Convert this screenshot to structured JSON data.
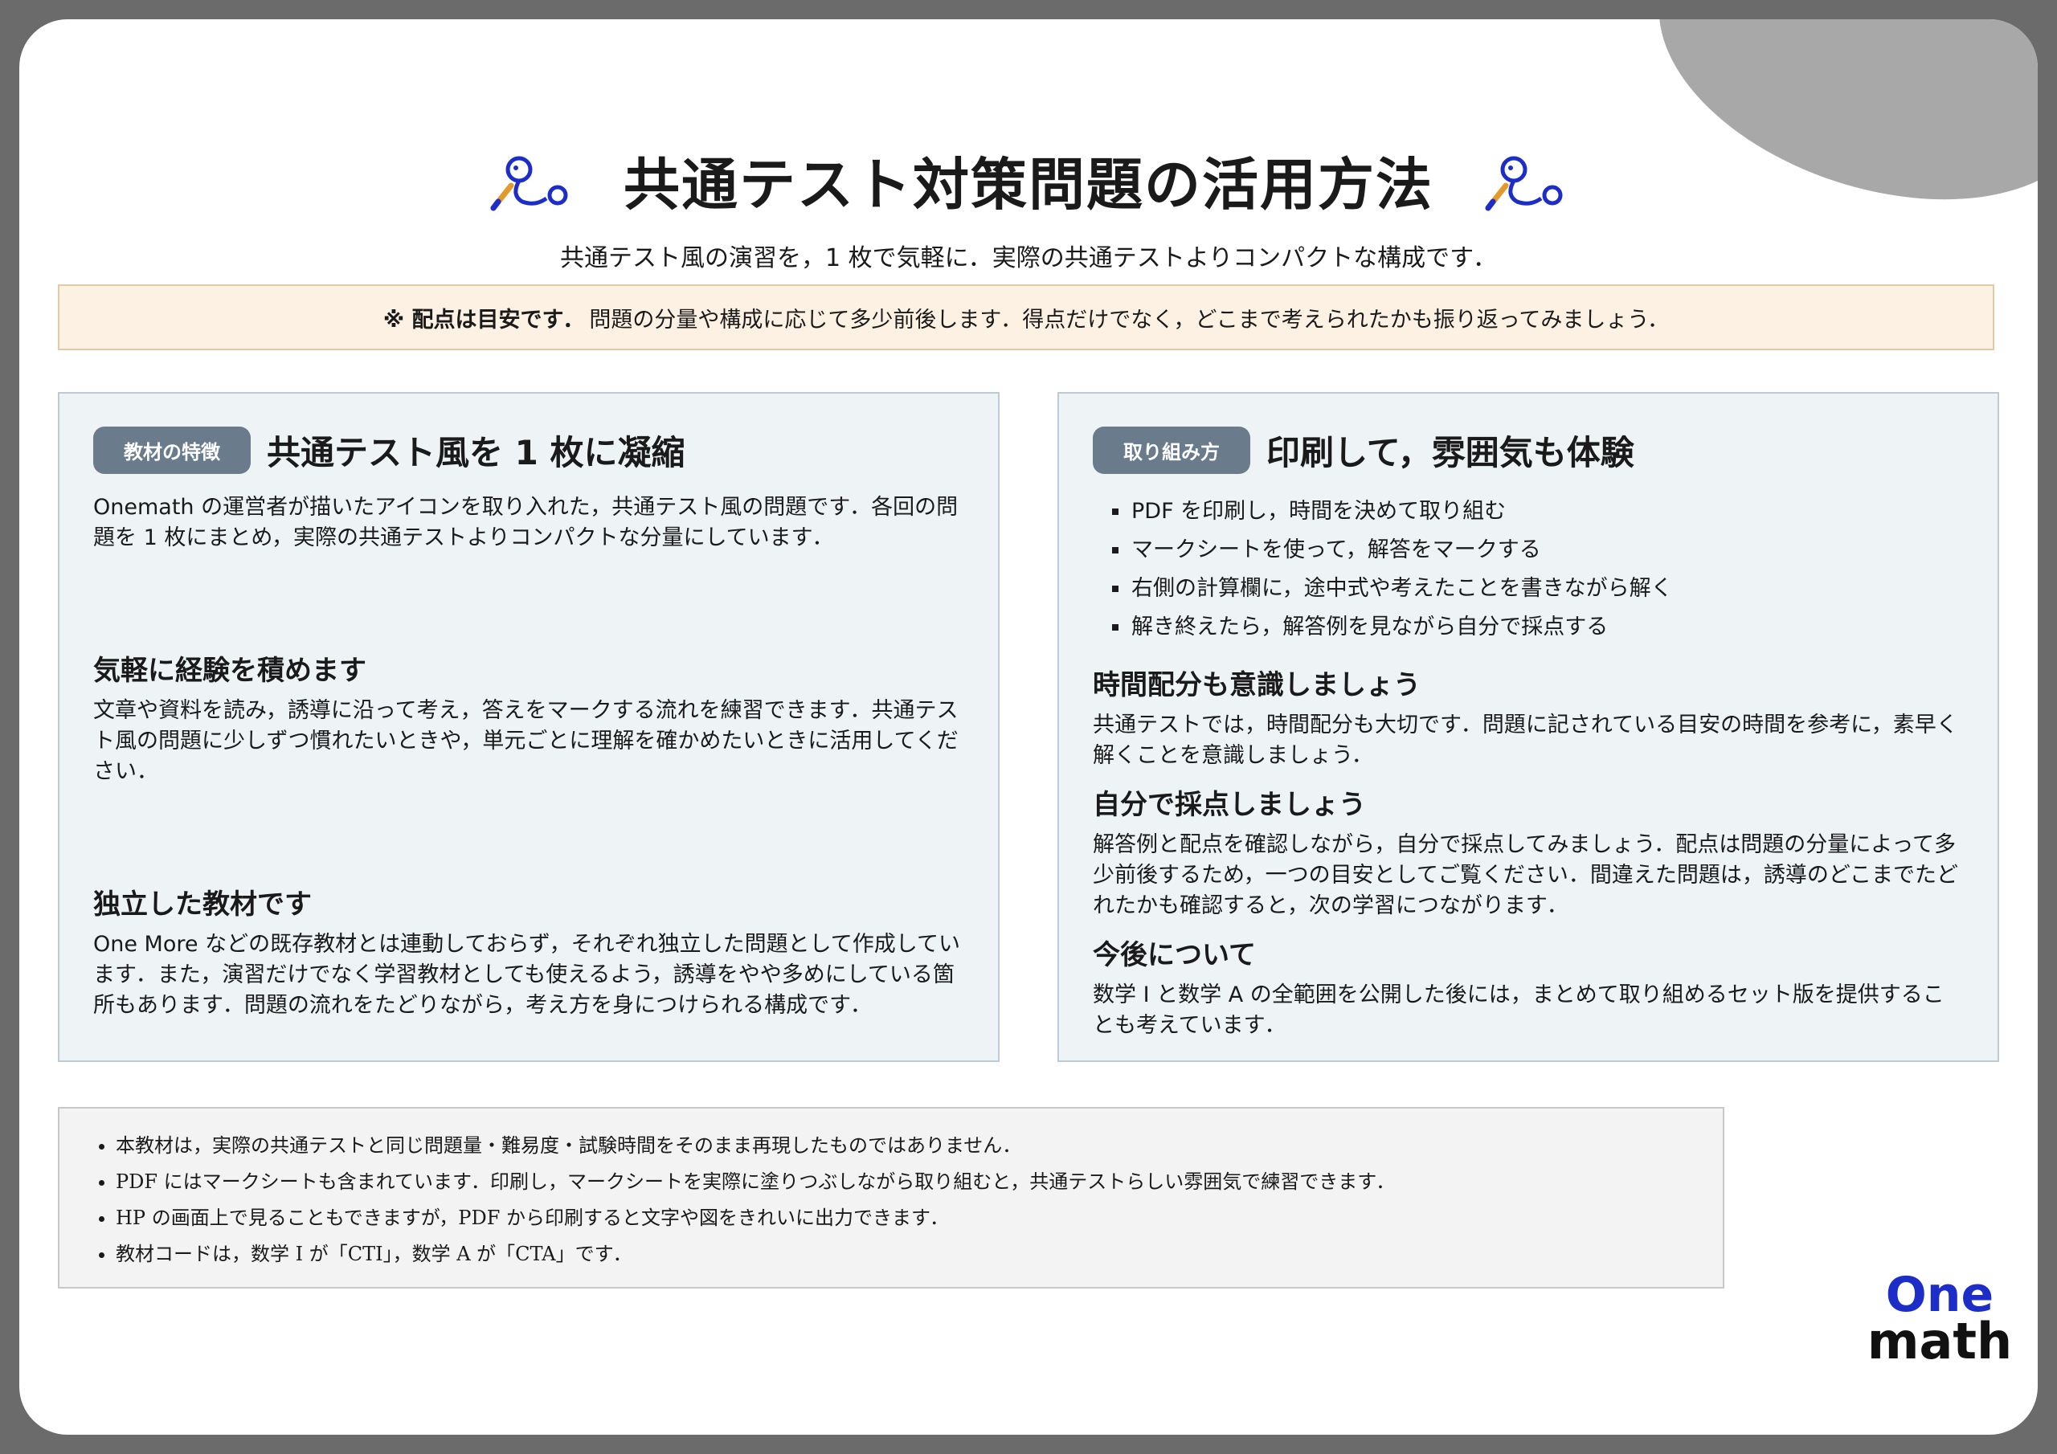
{
  "header": {
    "title": "共通テスト対策問題の活用方法",
    "subtitle": "共通テスト風の演習を，1 枚で気軽に．実際の共通テストよりコンパクトな構成です．"
  },
  "notice": {
    "bold": "※ 配点は目安です．",
    "text": "問題の分量や構成に応じて多少前後します．得点だけでなく，どこまで考えられたかも振り返ってみましょう．"
  },
  "left_panel": {
    "tag": "教材の特徴",
    "heading": "共通テスト風を 1 枚に凝縮",
    "intro": "Onemath の運営者が描いたアイコンを取り入れた，共通テスト風の問題です．各回の問題を 1 枚にまとめ，実際の共通テストよりコンパクトな分量にしています．",
    "sections": [
      {
        "heading": "気軽に経験を積めます",
        "text": "文章や資料を読み，誘導に沿って考え，答えをマークする流れを練習できます．共通テスト風の問題に少しずつ慣れたいときや，単元ごとに理解を確かめたいときに活用してください．"
      },
      {
        "heading": "独立した教材です",
        "text": "One More などの既存教材とは連動しておらず，それぞれ独立した問題として作成しています．また，演習だけでなく学習教材としても使えるよう，誘導をやや多めにしている箇所もあります．問題の流れをたどりながら，考え方を身につけられる構成です．"
      }
    ]
  },
  "right_panel": {
    "tag": "取り組み方",
    "heading": "印刷して，雰囲気も体験",
    "steps": [
      "PDF を印刷し，時間を決めて取り組む",
      "マークシートを使って，解答をマークする",
      "右側の計算欄に，途中式や考えたことを書きながら解く",
      "解き終えたら，解答例を見ながら自分で採点する"
    ],
    "sections": [
      {
        "heading": "時間配分も意識しましょう",
        "text": "共通テストでは，時間配分も大切です．問題に記されている目安の時間を参考に，素早く解くことを意識しましょう．"
      },
      {
        "heading": "自分で採点しましょう",
        "text": "解答例と配点を確認しながら，自分で採点してみましょう．配点は問題の分量によって多少前後するため，一つの目安としてご覧ください．間違えた問題は，誘導のどこまでたどれたかも確認すると，次の学習につながります．"
      },
      {
        "heading": "今後について",
        "text": "数学 I と数学 A の全範囲を公開した後には，まとめて取り組めるセット版を提供することも考えています．"
      }
    ]
  },
  "footnotes": [
    "本教材は，実際の共通テストと同じ問題量・難易度・試験時間をそのまま再現したものではありません．",
    "PDF にはマークシートも含まれています．印刷し，マークシートを実際に塗りつぶしながら取り組むと，共通テストらしい雰囲気で練習できます．",
    "HP の画面上で見ることもできますが，PDF から印刷すると文字や図をきれいに出力できます．",
    "教材コードは，数学 I が「CTI」，数学 A が「CTA」です．"
  ],
  "logo": {
    "line1": "One",
    "line2": "math"
  },
  "colors": {
    "accent": "#1d2ec8",
    "tag_bg": "#6a7c8c",
    "panel_bg": "#eef3f6",
    "notice_bg": "#fdf1e4"
  }
}
